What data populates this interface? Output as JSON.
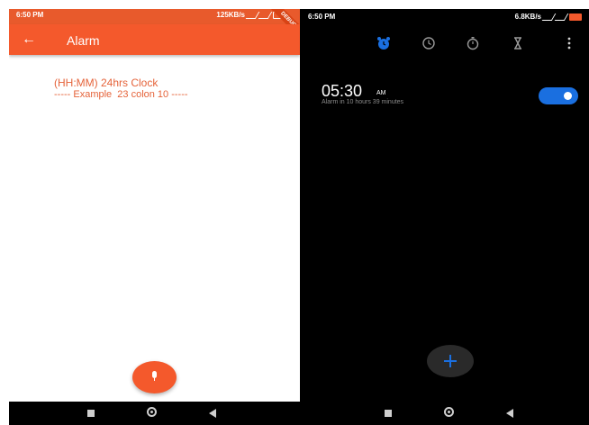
{
  "left_phone": {
    "status_bar": {
      "time": "6:50 PM",
      "speed": "125KB/s",
      "debug_banner": "DEBUG"
    },
    "app_bar": {
      "title": "Alarm"
    },
    "content": {
      "instruction_line1": "(HH:MM) 24hrs Clock",
      "instruction_line2": "----- Example  23 colon 10 -----"
    },
    "icons": {
      "back": "arrow-left-icon",
      "fab": "microphone-icon"
    },
    "colors": {
      "primary": "#f4592c",
      "status": "#e85a2c",
      "text_accent": "#e5633a"
    }
  },
  "right_phone": {
    "status_bar": {
      "time": "6:50 PM",
      "speed": "6.8KB/s"
    },
    "tabs": [
      {
        "name": "alarm",
        "icon": "alarm-clock-icon",
        "active": true
      },
      {
        "name": "clock",
        "icon": "clock-icon",
        "active": false
      },
      {
        "name": "stopwatch",
        "icon": "stopwatch-icon",
        "active": false
      },
      {
        "name": "timer",
        "icon": "hourglass-icon",
        "active": false
      }
    ],
    "alarm": {
      "time": "05:30",
      "ampm": "AM",
      "subtitle": "Alarm in 10 hours 39 minutes",
      "enabled": true
    },
    "colors": {
      "background": "#000000",
      "accent": "#1a6fe0",
      "muted_text": "#8a8a8a"
    }
  }
}
